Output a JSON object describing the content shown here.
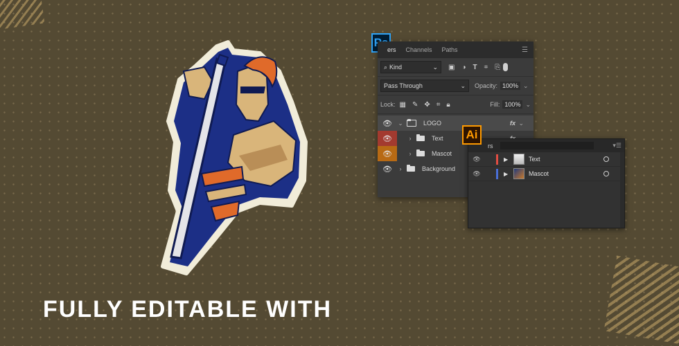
{
  "headline": "FULLY EDITABLE WITH",
  "photoshop": {
    "badge": "Ps",
    "tabs": [
      {
        "label": "ers"
      },
      {
        "label": "Channels"
      },
      {
        "label": "Paths"
      }
    ],
    "filter": {
      "label": "Kind"
    },
    "blend_mode": "Pass Through",
    "opacity_label": "Opacity:",
    "opacity_value": "100%",
    "lock_label": "Lock:",
    "fill_label": "Fill:",
    "fill_value": "100%",
    "layers": [
      {
        "name": "LOGO",
        "fx": "fx",
        "expanded": true
      },
      {
        "name": "Text",
        "fx": "fx"
      },
      {
        "name": "Mascot",
        "fx": ""
      },
      {
        "name": "Background",
        "fx": ""
      }
    ]
  },
  "illustrator": {
    "badge": "Ai",
    "tab": "rs",
    "layers": [
      {
        "name": "Text",
        "color": "#e24d43"
      },
      {
        "name": "Mascot",
        "color": "#4a6fd8"
      }
    ]
  },
  "colors": {
    "background": "#544a33",
    "ps_brand": "#2fa3f7",
    "ai_brand": "#ff9a00",
    "mascot_blue": "#1c2f86",
    "mascot_orange": "#e06a2a",
    "mascot_tan": "#d9b57a"
  }
}
